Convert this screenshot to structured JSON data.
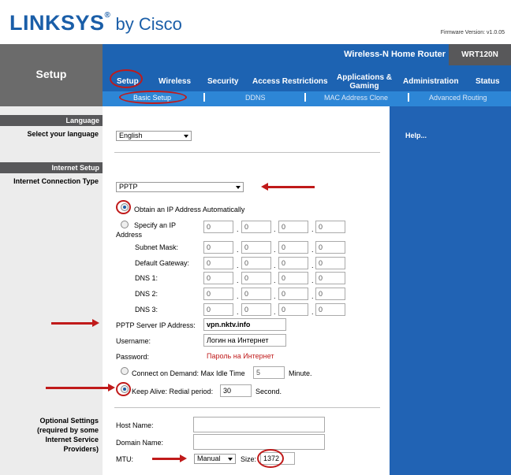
{
  "header": {
    "logo_main": "LINKSYS",
    "logo_reg": "®",
    "logo_by": " by Cisco",
    "firmware": "Firmware Version: v1.0.05"
  },
  "nav": {
    "section_title": "Setup",
    "product_name": "Wireless-N Home Router",
    "model": "WRT120N",
    "tabs": [
      "Setup",
      "Wireless",
      "Security",
      "Access Restrictions",
      "Applications &",
      "Gaming",
      "Administration",
      "Status"
    ],
    "subtabs": [
      "Basic Setup",
      "DDNS",
      "MAC Address Clone",
      "Advanced Routing"
    ]
  },
  "left": {
    "language_head": "Language",
    "language_label": "Select your language",
    "internet_head": "Internet Setup",
    "internet_label": "Internet Connection Type",
    "optional_1": "Optional Settings",
    "optional_2": "(required by some",
    "optional_3": "Internet Service",
    "optional_4": "Providers)"
  },
  "form": {
    "language_value": "English",
    "connection_type": "PPTP",
    "obtain_ip": "Obtain an IP Address Automatically",
    "specify_ip_1": "Specify an IP",
    "specify_ip_2": "Address",
    "subnet_mask": "Subnet Mask:",
    "default_gateway": "Default Gateway:",
    "dns1": "DNS 1:",
    "dns2": "DNS 2:",
    "dns3": "DNS 3:",
    "ip_zero": "0",
    "pptp_server_label": "PPTP Server IP Address:",
    "pptp_server_value": "vpn.nktv.info",
    "username_label": "Username:",
    "username_value": "Логин на Интернет",
    "password_label": "Password:",
    "password_value": "Пароль на Интернет",
    "connect_on_demand": "Connect on Demand: Max Idle Time",
    "idle_time_value": "5",
    "minute": "Minute.",
    "keep_alive": "Keep Alive: Redial period:",
    "redial_value": "30",
    "second": "Second.",
    "host_name_label": "Host Name:",
    "domain_name_label": "Domain Name:",
    "mtu_label": "MTU:",
    "mtu_value": "Manual",
    "size_label": "Size:",
    "size_value": "1372"
  },
  "help": {
    "label": "Help..."
  },
  "colors": {
    "brand_blue": "#1d63b2",
    "annotation_red": "#c01a1a"
  }
}
